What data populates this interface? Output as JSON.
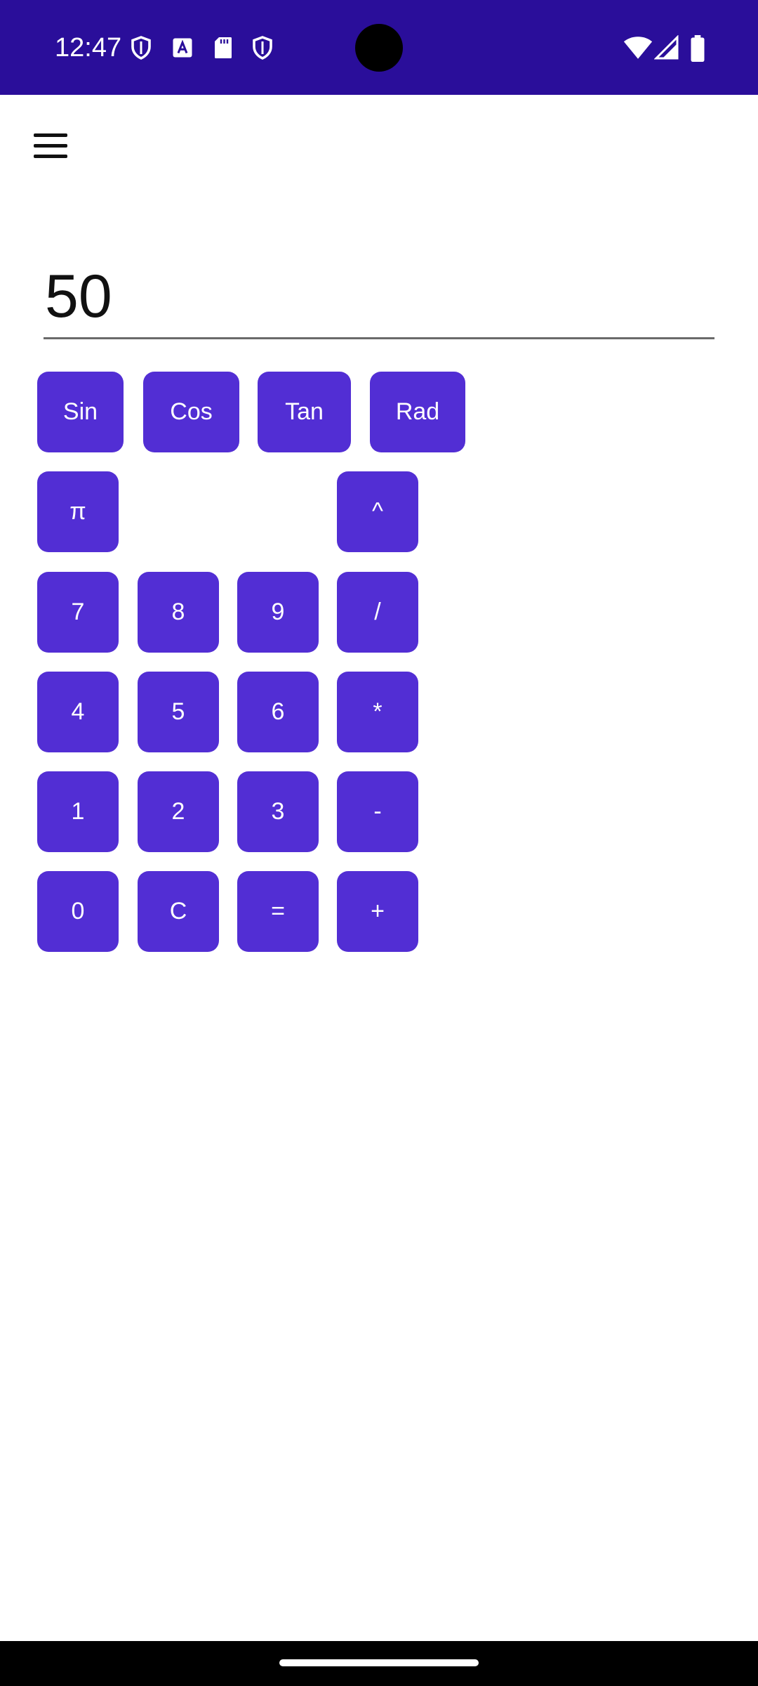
{
  "status_bar": {
    "time": "12:47",
    "background_color": "#2a0e9a",
    "icons_left": [
      "shield-icon",
      "text-a-icon",
      "sd-card-icon",
      "shield-icon"
    ],
    "icons_right": [
      "wifi-icon",
      "cellular-signal-icon",
      "battery-icon"
    ]
  },
  "app": {
    "menu_icon": "hamburger-menu-icon",
    "display_value": "50",
    "accent_color": "#522ed4"
  },
  "keypad": {
    "row1": [
      "Sin",
      "Cos",
      "Tan",
      "Rad"
    ],
    "row2": [
      "π",
      "^"
    ],
    "row3": [
      "7",
      "8",
      "9",
      "/"
    ],
    "row4": [
      "4",
      "5",
      "6",
      "*"
    ],
    "row5": [
      "1",
      "2",
      "3",
      "-"
    ],
    "row6": [
      "0",
      "C",
      "=",
      "+"
    ]
  }
}
